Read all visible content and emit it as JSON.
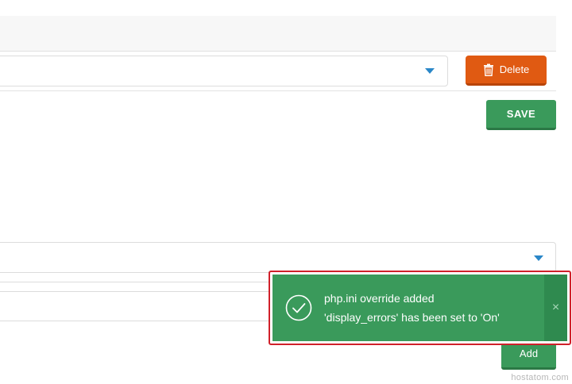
{
  "toolbar": {
    "delete_label": "Delete",
    "save_label": "SAVE"
  },
  "form": {
    "add_label": "Add"
  },
  "toast": {
    "title": "php.ini override added",
    "message": "'display_errors' has been set to 'On'",
    "close_symbol": "×"
  },
  "watermark": "hostatom.com",
  "colors": {
    "success": "#3a9a5b",
    "danger": "#e05a12",
    "accent": "#2a87c8",
    "highlight": "#d0202a"
  },
  "icons": {
    "delete": "trash-icon",
    "toast": "check-circle-icon",
    "close": "close-icon",
    "dropdown": "chevron-down-icon"
  }
}
